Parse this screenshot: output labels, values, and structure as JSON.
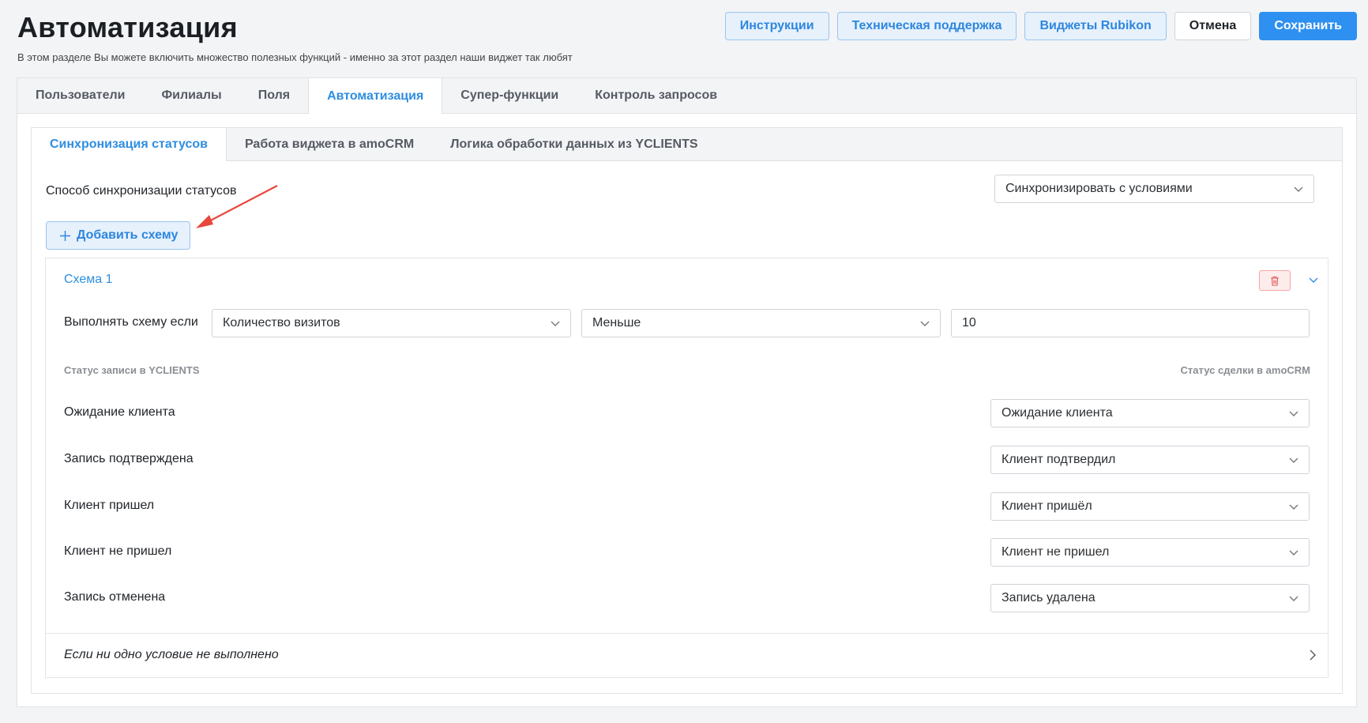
{
  "header": {
    "title": "Автоматизация",
    "subtitle": "В этом разделе Вы можете включить множество полезных функций - именно за этот раздел наши виджет так любят"
  },
  "top_actions": {
    "instructions": "Инструкции",
    "support": "Техническая поддержка",
    "widgets": "Виджеты Rubikon",
    "cancel": "Отмена",
    "save": "Сохранить"
  },
  "main_tabs": [
    "Пользователи",
    "Филиалы",
    "Поля",
    "Автоматизация",
    "Супер-функции",
    "Контроль запросов"
  ],
  "main_tab_active": "Автоматизация",
  "sub_tabs": [
    "Синхронизация статусов",
    "Работа виджета в amoCRM",
    "Логика обработки данных из YCLIENTS"
  ],
  "sub_tab_active": "Синхронизация статусов",
  "sync": {
    "label": "Способ синхронизации статусов",
    "value": "Синхронизировать с условиями"
  },
  "add_scheme_label": "Добавить схему",
  "scheme": {
    "title": "Схема 1",
    "condition_label": "Выполнять схему если",
    "condition_field": "Количество визитов",
    "condition_operator": "Меньше",
    "condition_value": "10",
    "col_left": "Статус записи в YCLIENTS",
    "col_right": "Статус сделки в amoCRM",
    "rows": [
      {
        "yclients": "Ожидание клиента",
        "amocrm": "Ожидание клиента"
      },
      {
        "yclients": "Запись подтверждена",
        "amocrm": "Клиент подтвердил"
      },
      {
        "yclients": "Клиент пришел",
        "amocrm": "Клиент пришёл"
      },
      {
        "yclients": "Клиент не пришел",
        "amocrm": "Клиент не пришел"
      },
      {
        "yclients": "Запись отменена",
        "amocrm": "Запись удалена"
      }
    ],
    "fallback_label": "Если ни одно условие не выполнено"
  },
  "colors": {
    "accent": "#2e8ee0",
    "primary_button": "#2e90f0",
    "danger": "#e05656",
    "annotation_arrow": "#e8473c"
  }
}
